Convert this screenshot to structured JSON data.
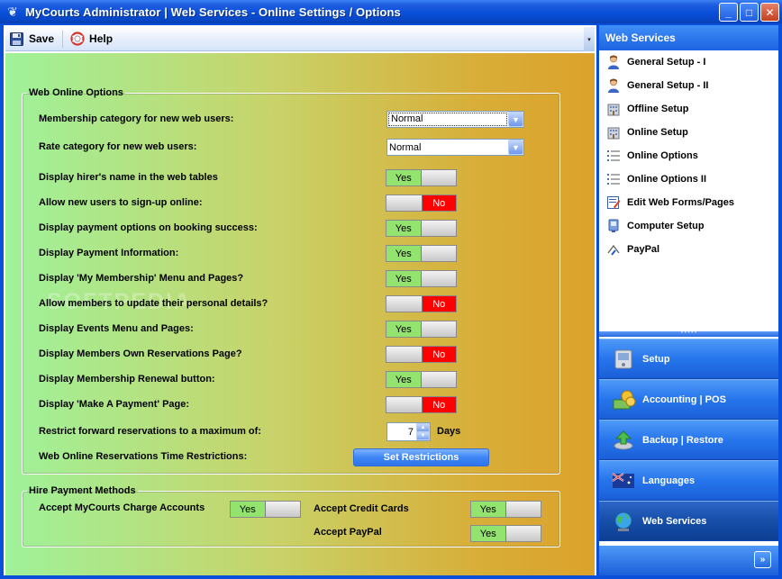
{
  "window": {
    "title": "MyCourts Administrator | Web Services - Online Settings / Options",
    "controls": {
      "minimize": "_",
      "maximize": "□",
      "close": "✕"
    }
  },
  "toolbar": {
    "save_label": "Save",
    "help_label": "Help",
    "overflow": "▾"
  },
  "web_options": {
    "legend": "Web Online Options",
    "membership_category_label": "Membership category for new web users:",
    "membership_category_value": "Normal",
    "rate_category_label": "Rate category for new web users:",
    "rate_category_value": "Normal",
    "toggles": [
      {
        "label": "Display hirer's name in the web tables",
        "value": "Yes"
      },
      {
        "label": "Allow new users to sign-up online:",
        "value": "No"
      },
      {
        "label": "Display payment options on booking success:",
        "value": "Yes"
      },
      {
        "label": "Display Payment Information:",
        "value": "Yes"
      },
      {
        "label": "Display 'My Membership' Menu and Pages?",
        "value": "Yes"
      },
      {
        "label": "Allow members to update their personal details?",
        "value": "No"
      },
      {
        "label": "Display Events Menu and Pages:",
        "value": "Yes"
      },
      {
        "label": "Display Members Own Reservations Page?",
        "value": "No"
      },
      {
        "label": "Display Membership Renewal button:",
        "value": "Yes"
      },
      {
        "label": "Display 'Make A Payment' Page:",
        "value": "No"
      }
    ],
    "restrict_label": "Restrict forward reservations to a maximum of:",
    "restrict_value": "7",
    "restrict_unit": "Days",
    "time_restrictions_label": "Web Online Reservations Time Restrictions:",
    "set_restrictions_label": "Set Restrictions"
  },
  "watermark": "SOFTPEDIA",
  "hire_payment": {
    "legend": "Hire Payment Methods",
    "charge_accounts_label": "Accept MyCourts Charge Accounts",
    "charge_accounts_value": "Yes",
    "credit_cards_label": "Accept Credit Cards",
    "credit_cards_value": "Yes",
    "paypal_label": "Accept PayPal",
    "paypal_value": "Yes"
  },
  "sidebar": {
    "header": "Web Services",
    "items": [
      {
        "label": "General Setup - I",
        "icon": "user-icon"
      },
      {
        "label": "General Setup - II",
        "icon": "user-icon"
      },
      {
        "label": "Offline Setup",
        "icon": "building-icon"
      },
      {
        "label": "Online Setup",
        "icon": "building-icon"
      },
      {
        "label": "Online Options",
        "icon": "list-icon"
      },
      {
        "label": "Online Options II",
        "icon": "list-icon"
      },
      {
        "label": "Edit Web Forms/Pages",
        "icon": "edit-form-icon"
      },
      {
        "label": "Computer Setup",
        "icon": "computer-icon"
      },
      {
        "label": "PayPal",
        "icon": "paypal-icon"
      }
    ],
    "sections": [
      {
        "label": "Setup",
        "icon": "setup-icon"
      },
      {
        "label": "Accounting | POS",
        "icon": "money-icon"
      },
      {
        "label": "Backup | Restore",
        "icon": "backup-icon"
      },
      {
        "label": "Languages",
        "icon": "flag-icon"
      },
      {
        "label": "Web Services",
        "icon": "globe-icon"
      }
    ],
    "expand": "»"
  },
  "colors": {
    "titlebar": "#0a4fd9",
    "yes_bg": "#93e36f",
    "no_bg": "#ff0000",
    "accent": "#2f74ea"
  }
}
